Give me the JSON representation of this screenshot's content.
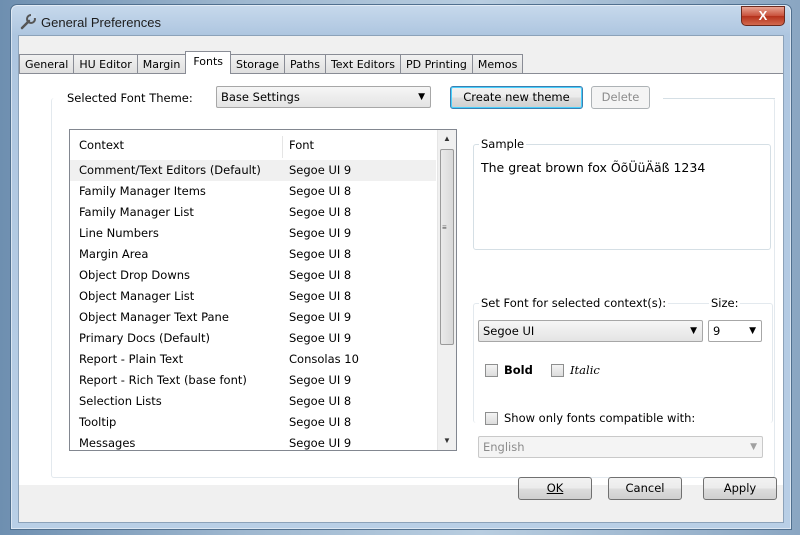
{
  "window": {
    "title": "General Preferences",
    "close_glyph": "X"
  },
  "tabs": [
    {
      "label": "General"
    },
    {
      "label": "HU Editor"
    },
    {
      "label": "Margin"
    },
    {
      "label": "Fonts",
      "active": true
    },
    {
      "label": "Storage"
    },
    {
      "label": "Paths"
    },
    {
      "label": "Text Editors"
    },
    {
      "label": "PD Printing"
    },
    {
      "label": "Memos"
    }
  ],
  "theme": {
    "label": "Selected Font Theme:",
    "value": "Base Settings",
    "create_button": "Create new theme",
    "delete_button": "Delete"
  },
  "contexts": {
    "headers": {
      "context": "Context",
      "font": "Font"
    },
    "rows": [
      {
        "context": "Comment/Text Editors (Default)",
        "font": "Segoe UI 9",
        "selected": true
      },
      {
        "context": "Family Manager Items",
        "font": "Segoe UI 8"
      },
      {
        "context": "Family Manager List",
        "font": "Segoe UI 8"
      },
      {
        "context": "Line Numbers",
        "font": "Segoe UI 9"
      },
      {
        "context": "Margin Area",
        "font": "Segoe UI 8"
      },
      {
        "context": "Object Drop Downs",
        "font": "Segoe UI 8"
      },
      {
        "context": "Object Manager List",
        "font": "Segoe UI 8"
      },
      {
        "context": "Object Manager Text Pane",
        "font": "Segoe UI 9"
      },
      {
        "context": "Primary Docs (Default)",
        "font": "Segoe UI 9"
      },
      {
        "context": "Report - Plain Text",
        "font": "Consolas 10"
      },
      {
        "context": "Report - Rich Text (base font)",
        "font": "Segoe UI 9"
      },
      {
        "context": "Selection Lists",
        "font": "Segoe UI 8"
      },
      {
        "context": "Tooltip",
        "font": "Segoe UI 8"
      },
      {
        "context": "Messages",
        "font": "Segoe UI 9"
      }
    ]
  },
  "sample": {
    "label": "Sample",
    "text": "The great brown fox ÕõÜüÄäß 1234"
  },
  "font_setter": {
    "label": "Set Font for selected context(s):",
    "size_label": "Size:",
    "font_value": "Segoe UI",
    "size_value": "9",
    "bold_label": "Bold",
    "italic_label": "Italic",
    "compat_label": "Show only fonts compatible with:",
    "compat_value": "English"
  },
  "footer": {
    "ok": "OK",
    "cancel": "Cancel",
    "apply": "Apply"
  },
  "icons": {
    "title": "wrench-icon",
    "dropdown": "chevron-down-icon",
    "scroll_up": "scroll-up-icon",
    "scroll_down": "scroll-down-icon"
  }
}
